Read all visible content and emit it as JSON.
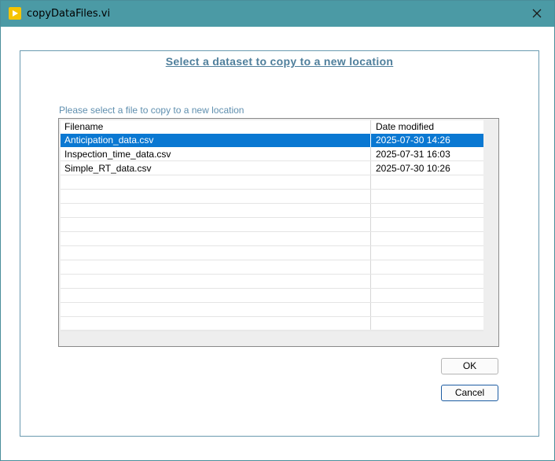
{
  "window": {
    "title": "copyDataFiles.vi"
  },
  "dialog": {
    "heading": "Select a dataset to copy to a new location",
    "list_label": "Please select a file to copy to a new location",
    "columns": {
      "filename": "Filename",
      "date_modified": "Date modified"
    },
    "files": [
      {
        "name": "Anticipation_data.csv",
        "modified": "2025-07-30 14:26",
        "selected": true
      },
      {
        "name": "Inspection_time_data.csv",
        "modified": "2025-07-31 16:03",
        "selected": false
      },
      {
        "name": "Simple_RT_data.csv",
        "modified": "2025-07-30 10:26",
        "selected": false
      }
    ],
    "ok_label": "OK",
    "cancel_label": "Cancel"
  },
  "colors": {
    "titlebar": "#4b9aa5",
    "selection": "#0a78d2",
    "heading": "#4f7f9c",
    "app_icon": "#f5c400"
  },
  "icons": {
    "app": "labview-vi-icon",
    "close": "close-icon"
  }
}
